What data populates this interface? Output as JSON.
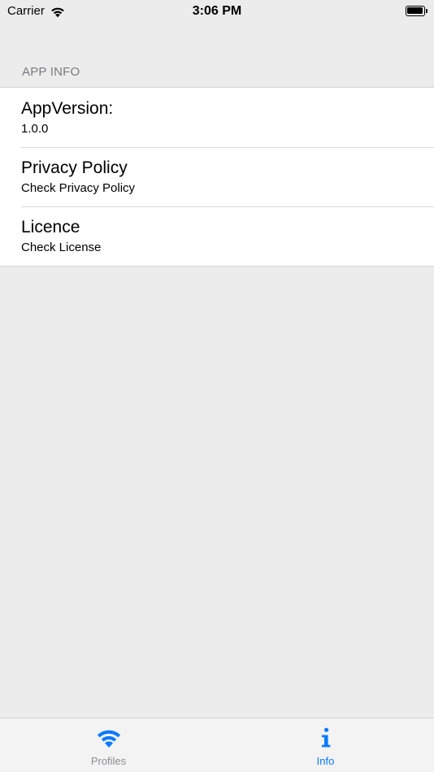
{
  "status_bar": {
    "carrier": "Carrier",
    "time": "3:06 PM",
    "icons": [
      "wifi-icon",
      "battery-icon"
    ]
  },
  "section": {
    "header": "APP INFO"
  },
  "rows": [
    {
      "title": "AppVersion:",
      "subtitle": "1.0.0"
    },
    {
      "title": "Privacy Policy",
      "subtitle": "Check Privacy Policy"
    },
    {
      "title": "Licence",
      "subtitle": "Check License"
    }
  ],
  "tab_bar": {
    "tabs": [
      {
        "label": "Profiles",
        "icon": "wifi-icon",
        "active": false
      },
      {
        "label": "Info",
        "icon": "info-icon",
        "active": true
      }
    ]
  },
  "colors": {
    "accent": "#0a7aff",
    "background": "#ececec",
    "inactive_tab": "#8e8e93",
    "section_header": "#7b7b80"
  }
}
